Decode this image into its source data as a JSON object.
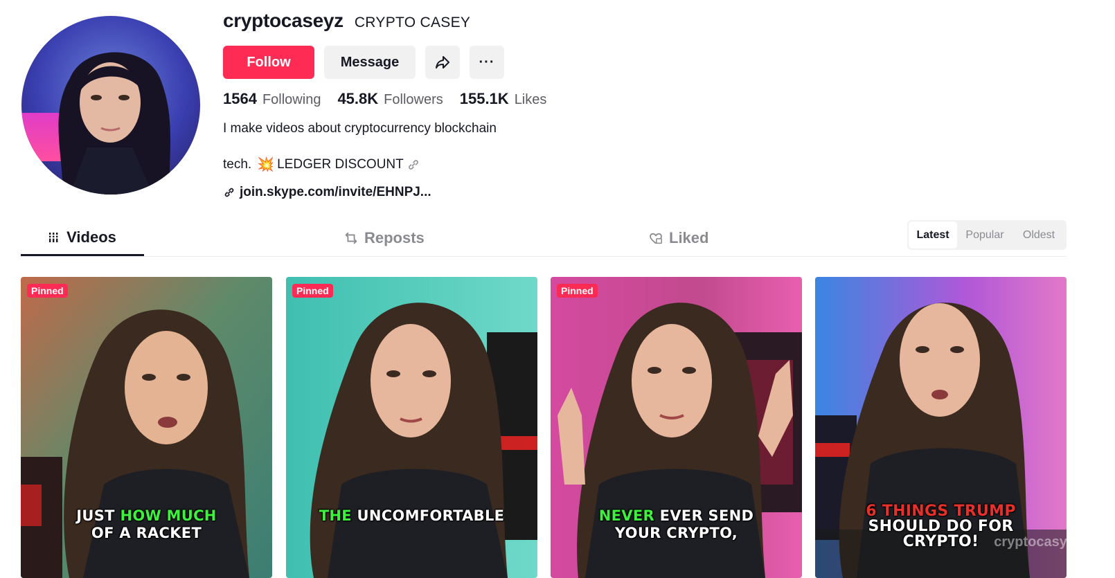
{
  "profile": {
    "username": "cryptocaseyz",
    "nickname": "CRYPTO CASEY",
    "avatar_icon": "profile-photo"
  },
  "actions": {
    "follow_label": "Follow",
    "message_label": "Message",
    "share_icon": "share-icon",
    "more_icon": "more-icon",
    "more_glyph": "···"
  },
  "stats": {
    "following_count": "1564",
    "following_label": "Following",
    "followers_count": "45.8K",
    "followers_label": "Followers",
    "likes_count": "155.1K",
    "likes_label": "Likes"
  },
  "bio": {
    "line1": "I make videos about cryptocurrency blockchain",
    "line2_text": "tech.",
    "line2_emoji": "💥",
    "line2_link": "LEDGER DISCOUNT",
    "link": "join.skype.com/invite/EHNPJ..."
  },
  "tabs": {
    "videos": "Videos",
    "reposts": "Reposts",
    "liked": "Liked"
  },
  "sort": {
    "latest": "Latest",
    "popular": "Popular",
    "oldest": "Oldest",
    "selected": "Latest"
  },
  "videos": [
    {
      "pinned": "Pinned",
      "caption_l1_a": "JUST ",
      "caption_l1_b": "HOW MUCH",
      "caption_l2": "OF A RACKET"
    },
    {
      "pinned": "Pinned",
      "caption_l1_a": "THE",
      "caption_l1_b": " UNCOMFORTABLE",
      "caption_l2": ""
    },
    {
      "pinned": "Pinned",
      "caption_l1_a": "NEVER",
      "caption_l1_b": " EVER SEND",
      "caption_l2": "YOUR CRYPTO,"
    },
    {
      "pinned": "",
      "caption_l1_a": "6 THINGS TRUMP",
      "caption_l1_b": "SHOULD DO FOR",
      "caption_l2": "CRYPTO!",
      "watermark": "cryptocasys"
    }
  ],
  "colors": {
    "accent": "#fe2c55",
    "text": "#161823",
    "muted": "#8a8b91",
    "caption_green": "#3df23d",
    "caption_red": "#e8302a"
  }
}
